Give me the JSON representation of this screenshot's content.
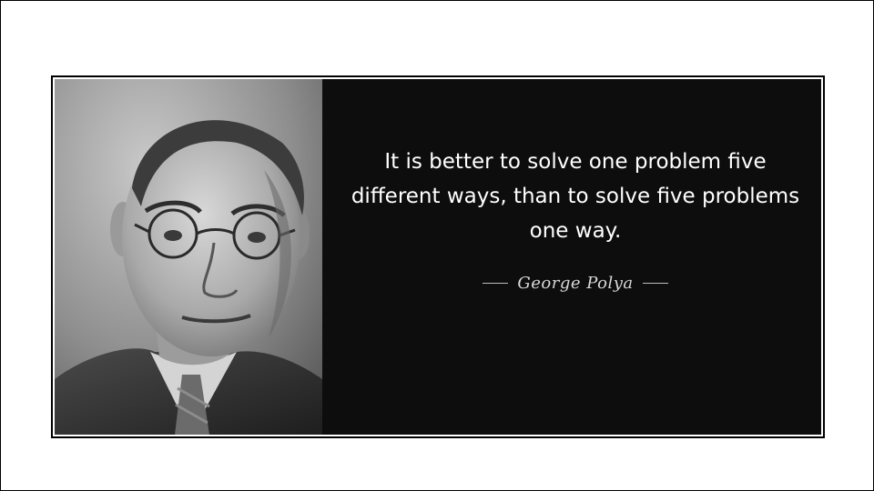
{
  "quote": {
    "text": "It is better to solve one problem five different ways, than to solve five problems one way.",
    "author": "George Polya"
  },
  "colors": {
    "page_background": "#ffffff",
    "card_background": "#0d0d0d",
    "quote_text": "#ffffff",
    "author_text": "#d8d8d8"
  },
  "portrait": {
    "icon": "portrait-photo"
  }
}
